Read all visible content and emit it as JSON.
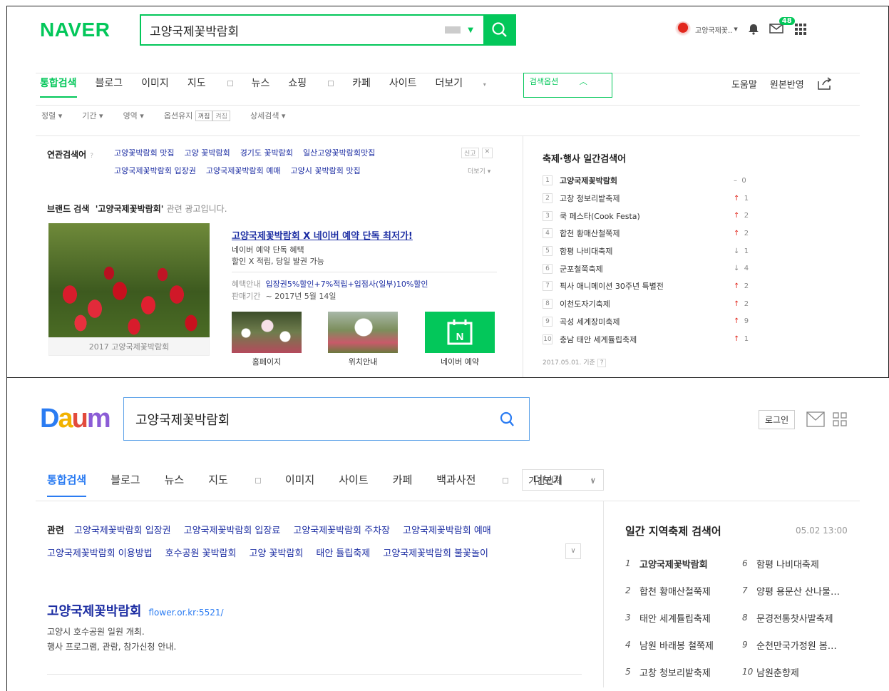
{
  "naver": {
    "logo": "NAVER",
    "query": "고양국제꽃박람회",
    "user_name": "고양국제꽃..",
    "mail_count": "48",
    "tabs": [
      "통합검색",
      "블로그",
      "이미지",
      "지도",
      "뉴스",
      "쇼핑",
      "카페",
      "사이트",
      "더보기"
    ],
    "search_option": "검색옵션",
    "right_links": [
      "도움말",
      "원본반영"
    ],
    "filters": [
      "정렬",
      "기간",
      "영역",
      "옵션유지",
      "상세검색"
    ],
    "filter_toggle": [
      "꺼짐",
      "켜짐"
    ],
    "related_label": "연관검색어",
    "related_row1": [
      "고양꽃박람회 맛집",
      "고양 꽃박람회",
      "경기도 꽃박람회",
      "일산고양꽃박람회맛집"
    ],
    "related_row2": [
      "고양국제꽃박람회 입장권",
      "고양국제꽃박람회 예매",
      "고양시 꽃박람회 맛집"
    ],
    "report": "신고",
    "more": "더보기",
    "brand_label": "브랜드 검색",
    "brand_query": "'고양국제꽃박람회'",
    "brand_suffix": "관련 광고입니다.",
    "image_caption": "2017 고양국제꽃박람회",
    "ad_title": "고양국제꽃박람회 X 네이버 예약 단독 최저가!",
    "ad_desc1": "네이버 예약 단독 혜택",
    "ad_desc2": "할인 X 적립, 당일 발권 가능",
    "benefit_label": "혜택안내",
    "benefit_text": "입장권5%할인+7%적립+입점사(일부)10%할인",
    "period_label": "판매기간",
    "period_text": "~ 2017년 5월 14일",
    "thumbs": [
      "홈페이지",
      "위치안내",
      "네이버 예약"
    ],
    "rank_title": "축제·행사 일간검색어",
    "ranks": [
      {
        "n": "1",
        "name": "고양국제꽃박람회",
        "dir": "–",
        "chg": "0"
      },
      {
        "n": "2",
        "name": "고창 청보리밭축제",
        "dir": "↑",
        "chg": "1"
      },
      {
        "n": "3",
        "name": "쿡 페스타(Cook Festa)",
        "dir": "↑",
        "chg": "2"
      },
      {
        "n": "4",
        "name": "합천 황매산철쭉제",
        "dir": "↑",
        "chg": "2"
      },
      {
        "n": "5",
        "name": "함평 나비대축제",
        "dir": "↓",
        "chg": "1"
      },
      {
        "n": "6",
        "name": "군포철쭉축제",
        "dir": "↓",
        "chg": "4"
      },
      {
        "n": "7",
        "name": "픽사 애니메이션 30주년 특별전",
        "dir": "↑",
        "chg": "2"
      },
      {
        "n": "8",
        "name": "이천도자기축제",
        "dir": "↑",
        "chg": "2"
      },
      {
        "n": "9",
        "name": "곡성 세계장미축제",
        "dir": "↑",
        "chg": "9"
      },
      {
        "n": "10",
        "name": "충남 태안 세계튤립축제",
        "dir": "↑",
        "chg": "1"
      }
    ],
    "rank_footer": "2017.05.01. 기준"
  },
  "daum": {
    "logo": "Daum",
    "query": "고양국제꽃박람회",
    "login": "로그인",
    "tabs": [
      "통합검색",
      "블로그",
      "뉴스",
      "지도",
      "이미지",
      "사이트",
      "카페",
      "백과사전",
      "더보기"
    ],
    "period": "기간전체",
    "related_label": "관련",
    "related_row1": [
      "고양국제꽃박람회 입장권",
      "고양국제꽃박람회 입장료",
      "고양국제꽃박람회 주차장",
      "고양국제꽃박람회 예매"
    ],
    "related_row2": [
      "고양국제꽃박람회 이용방법",
      "호수공원 꽃박람회",
      "고양 꽃박람회",
      "태안 튤립축제",
      "고양국제꽃박람회 불꽃놀이"
    ],
    "result_title": "고양국제꽃박람회",
    "result_url": "flower.or.kr:5521/",
    "result_desc1": "고양시 호수공원 일원 개최.",
    "result_desc2": "행사 프로그램, 관람, 참가신청 안내.",
    "rank_title": "일간 지역축제 검색어",
    "rank_time": "05.02 13:00",
    "ranks_left": [
      {
        "n": "1",
        "name": "고양국제꽃박람회"
      },
      {
        "n": "2",
        "name": "합천 황매산철쭉제"
      },
      {
        "n": "3",
        "name": "태안 세계튤립축제"
      },
      {
        "n": "4",
        "name": "남원 바래봉 철쭉제"
      },
      {
        "n": "5",
        "name": "고창 청보리밭축제"
      }
    ],
    "ranks_right": [
      {
        "n": "6",
        "name": "함평 나비대축제"
      },
      {
        "n": "7",
        "name": "양평 용문산 산나물…"
      },
      {
        "n": "8",
        "name": "문경전통찻사발축제"
      },
      {
        "n": "9",
        "name": "순천만국가정원 봄…"
      },
      {
        "n": "10",
        "name": "남원춘향제"
      }
    ]
  },
  "colors": {
    "naver_green": "#03c75a",
    "daum_blue": "#2b7cf2",
    "link_blue": "#1d2ea3",
    "rank_up": "#e2271d"
  }
}
